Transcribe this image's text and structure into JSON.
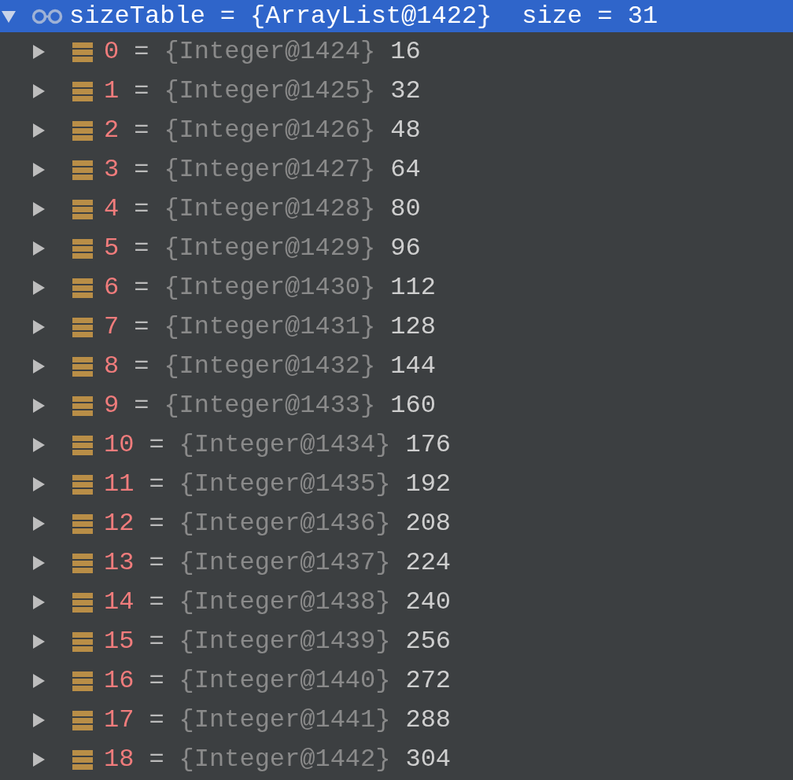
{
  "variables": {
    "root": {
      "name": "sizeTable",
      "separator": "=",
      "ref": "{ArrayList@1422}",
      "size": "size = 31",
      "expanded": true,
      "selected": true,
      "children": [
        {
          "name": "0",
          "separator": "=",
          "ref": "{Integer@1424}",
          "value": "16",
          "expanded": false,
          "selected": false
        },
        {
          "name": "1",
          "separator": "=",
          "ref": "{Integer@1425}",
          "value": "32",
          "expanded": false,
          "selected": false
        },
        {
          "name": "2",
          "separator": "=",
          "ref": "{Integer@1426}",
          "value": "48",
          "expanded": false,
          "selected": false
        },
        {
          "name": "3",
          "separator": "=",
          "ref": "{Integer@1427}",
          "value": "64",
          "expanded": false,
          "selected": false
        },
        {
          "name": "4",
          "separator": "=",
          "ref": "{Integer@1428}",
          "value": "80",
          "expanded": false,
          "selected": false
        },
        {
          "name": "5",
          "separator": "=",
          "ref": "{Integer@1429}",
          "value": "96",
          "expanded": false,
          "selected": false
        },
        {
          "name": "6",
          "separator": "=",
          "ref": "{Integer@1430}",
          "value": "112",
          "expanded": false,
          "selected": false
        },
        {
          "name": "7",
          "separator": "=",
          "ref": "{Integer@1431}",
          "value": "128",
          "expanded": false,
          "selected": false
        },
        {
          "name": "8",
          "separator": "=",
          "ref": "{Integer@1432}",
          "value": "144",
          "expanded": false,
          "selected": false
        },
        {
          "name": "9",
          "separator": "=",
          "ref": "{Integer@1433}",
          "value": "160",
          "expanded": false,
          "selected": false
        },
        {
          "name": "10",
          "separator": "=",
          "ref": "{Integer@1434}",
          "value": "176",
          "expanded": false,
          "selected": false
        },
        {
          "name": "11",
          "separator": "=",
          "ref": "{Integer@1435}",
          "value": "192",
          "expanded": false,
          "selected": false
        },
        {
          "name": "12",
          "separator": "=",
          "ref": "{Integer@1436}",
          "value": "208",
          "expanded": false,
          "selected": false
        },
        {
          "name": "13",
          "separator": "=",
          "ref": "{Integer@1437}",
          "value": "224",
          "expanded": false,
          "selected": false
        },
        {
          "name": "14",
          "separator": "=",
          "ref": "{Integer@1438}",
          "value": "240",
          "expanded": false,
          "selected": false
        },
        {
          "name": "15",
          "separator": "=",
          "ref": "{Integer@1439}",
          "value": "256",
          "expanded": false,
          "selected": false
        },
        {
          "name": "16",
          "separator": "=",
          "ref": "{Integer@1440}",
          "value": "272",
          "expanded": false,
          "selected": false
        },
        {
          "name": "17",
          "separator": "=",
          "ref": "{Integer@1441}",
          "value": "288",
          "expanded": false,
          "selected": false
        },
        {
          "name": "18",
          "separator": "=",
          "ref": "{Integer@1442}",
          "value": "304",
          "expanded": false,
          "selected": false
        }
      ]
    }
  }
}
